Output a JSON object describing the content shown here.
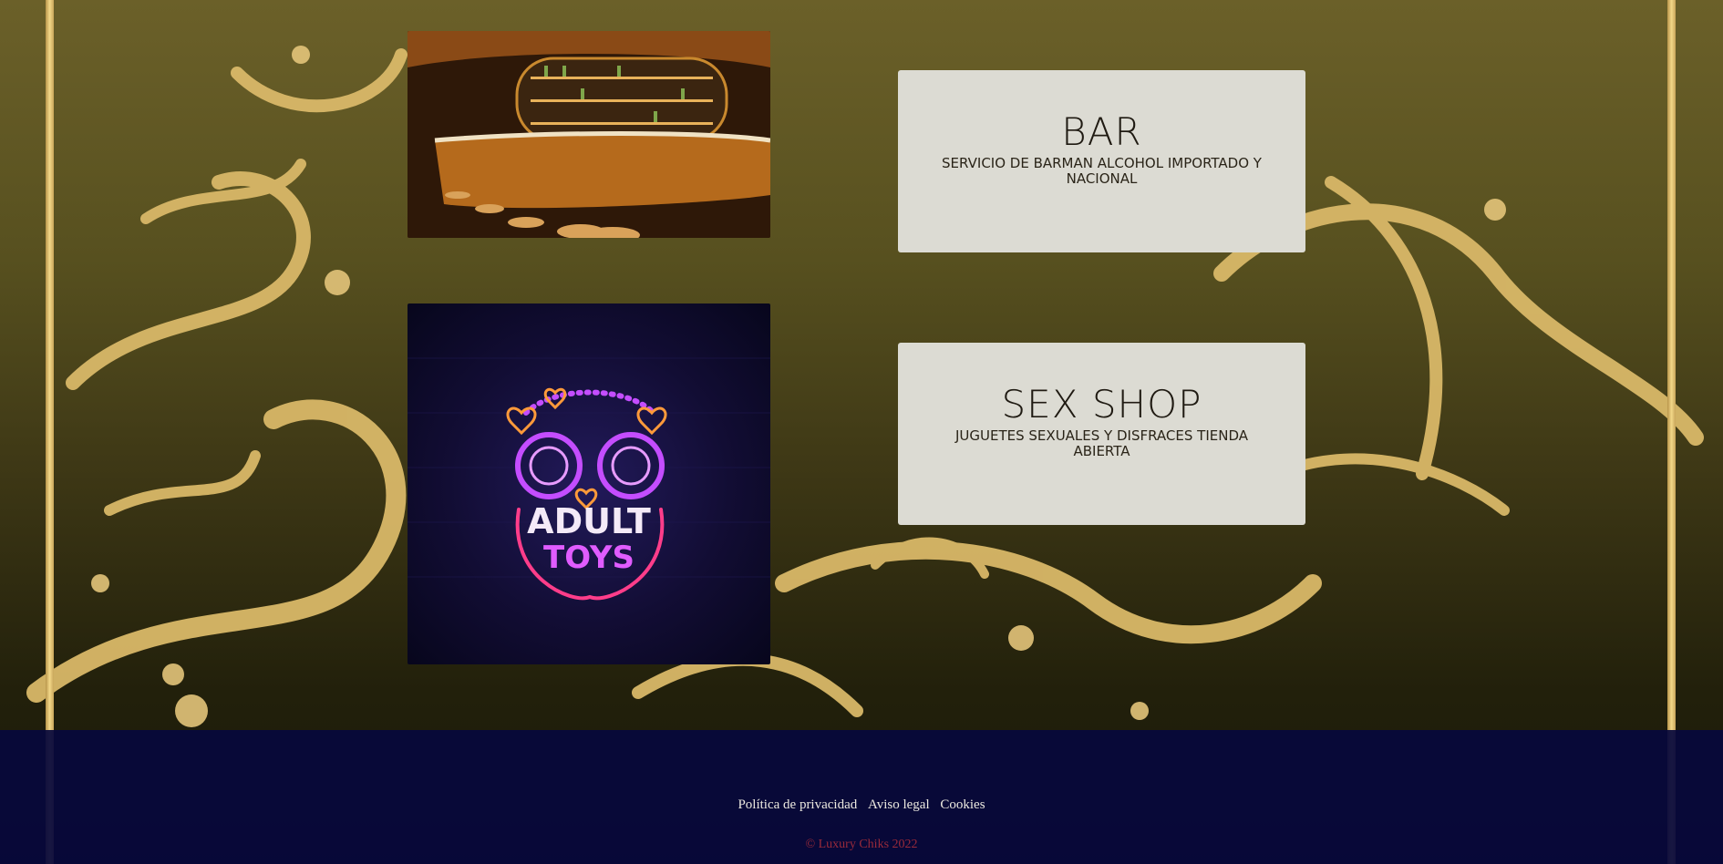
{
  "colors": {
    "gold": "#d9b868",
    "card_bg": "#dcdbd3",
    "footer_bg": "#06083c",
    "copyright": "#9a2a3a",
    "neon_pink": "#ff3d8a",
    "neon_purple": "#c44dff"
  },
  "services": [
    {
      "title": "BAR",
      "description": "SERVICIO DE BARMAN ALCOHOL IMPORTADO Y NACIONAL",
      "image_icon": "bar-counter-photo"
    },
    {
      "title": "SEX SHOP",
      "description": "JUGUETES SEXUALES Y DISFRACES TIENDA ABIERTA",
      "image_icon": "neon-handcuffs-sign",
      "sign_text": {
        "line1": "ADULT",
        "line2": "TOYS"
      }
    }
  ],
  "footer": {
    "links": [
      "Política de privacidad",
      "Aviso legal",
      "Cookies"
    ],
    "copyright": "© Luxury Chiks 2022"
  }
}
